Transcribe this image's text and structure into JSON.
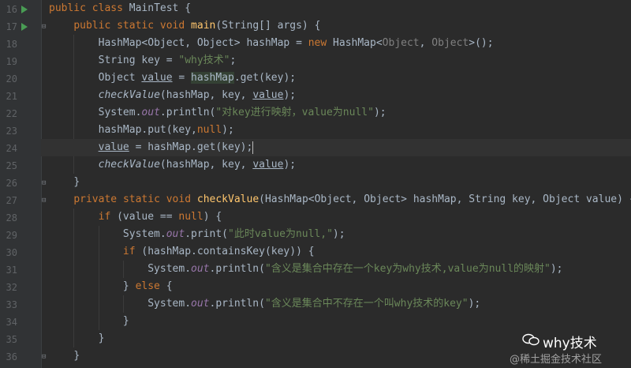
{
  "gutter": {
    "line_numbers": [
      "16",
      "17",
      "18",
      "19",
      "20",
      "21",
      "22",
      "23",
      "24",
      "25",
      "26",
      "27",
      "28",
      "29",
      "30",
      "31",
      "32",
      "33",
      "34",
      "35",
      "36"
    ]
  },
  "code": {
    "l16": [
      "public",
      "class",
      "MainTest",
      "{"
    ],
    "l17": [
      "public",
      "static",
      "void",
      "main",
      "(String[] args) {"
    ],
    "l18": [
      "HashMap<Object, Object> hashMap = ",
      "new",
      " HashMap<",
      "Object",
      ", ",
      "Object",
      ">();"
    ],
    "l19": [
      "String key = ",
      "\"why技术\"",
      ";"
    ],
    "l20": [
      "Object ",
      "value",
      " = ",
      "hashMap",
      ".get(key);"
    ],
    "l21": [
      "checkValue",
      "(hashMap, key, ",
      "value",
      ");"
    ],
    "l22": [
      "System.",
      "out",
      ".println(",
      "\"对key进行映射，value为null\"",
      ");"
    ],
    "l23": [
      "hashMap.put(key,",
      "null",
      ");"
    ],
    "l24": [
      "value",
      " = hashMap.get(key);"
    ],
    "l25": [
      "checkValue",
      "(hashMap, key, ",
      "value",
      ");"
    ],
    "l26": [
      "}"
    ],
    "l27": [
      "private",
      "static",
      "void",
      "checkValue",
      "(HashMap<Object, Object> hashMap, String key, Object value) {"
    ],
    "l28": [
      "if",
      " (value == ",
      "null",
      ") {"
    ],
    "l29": [
      "System.",
      "out",
      ".print(",
      "\"此时value为null,\"",
      ");"
    ],
    "l30": [
      "if",
      " (hashMap.containsKey(key)) {"
    ],
    "l31": [
      "System.",
      "out",
      ".println(",
      "\"含义是集合中存在一个key为why技术,value为null的映射\"",
      ");"
    ],
    "l32": [
      "} ",
      "else",
      " {"
    ],
    "l33": [
      "System.",
      "out",
      ".println(",
      "\"含义是集合中不存在一个叫why技术的key\"",
      ");"
    ],
    "l34": [
      "}"
    ],
    "l35": [
      "}"
    ],
    "l36": [
      "}"
    ]
  },
  "watermark": {
    "brand": "why技术",
    "sub": "@稀土掘金技术社区"
  },
  "colors": {
    "background": "#2b2b2b",
    "keyword": "#cc7832",
    "string": "#6a8759",
    "method": "#ffc66d",
    "static_field": "#9876aa",
    "text": "#a9b7c6"
  }
}
